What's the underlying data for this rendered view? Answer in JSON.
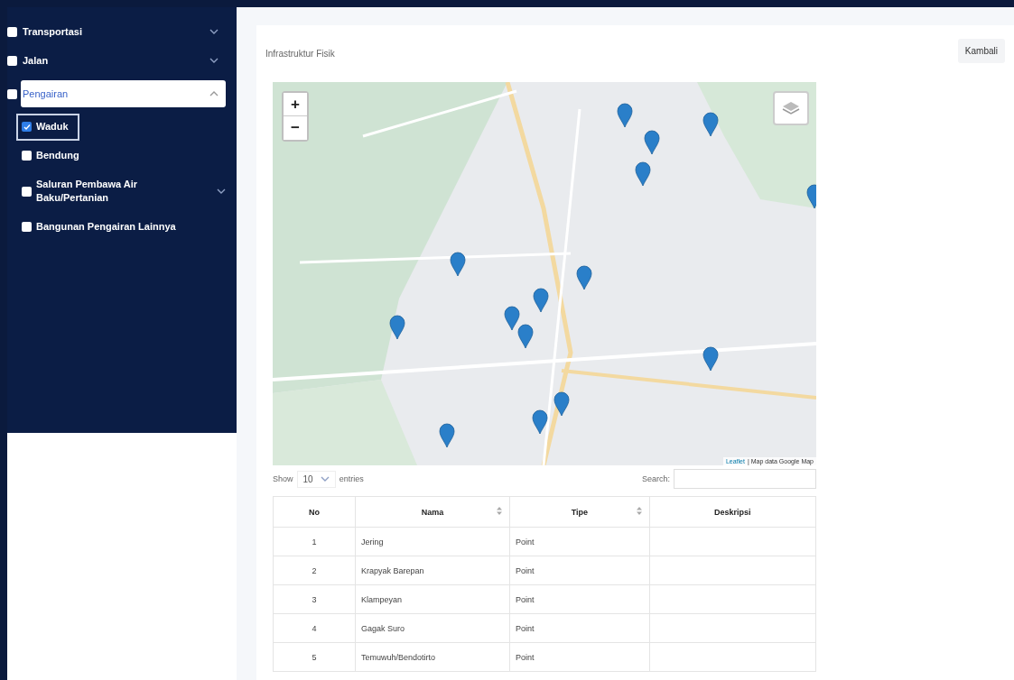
{
  "sidebar": {
    "items": [
      {
        "label": "Transportasi",
        "checked": false,
        "expanded": false
      },
      {
        "label": "Jalan",
        "checked": false,
        "expanded": false
      },
      {
        "label": "Pengairan",
        "checked": false,
        "expanded": true,
        "children": [
          {
            "label": "Waduk",
            "checked": true,
            "selected": true
          },
          {
            "label": "Bendung",
            "checked": false,
            "selected": false
          },
          {
            "label": "Saluran Pembawa Air Baku/Pertanian",
            "checked": false,
            "selected": false,
            "expanded": false
          },
          {
            "label": "Bangunan Pengairan Lainnya",
            "checked": false,
            "selected": false
          }
        ]
      }
    ]
  },
  "header": {
    "title": "Infrastruktur Fisik",
    "button": "Kambali"
  },
  "map": {
    "zoom_in": "+",
    "zoom_out": "−",
    "attribution_prefix": "Leaflet",
    "attribution": "| Map data Google Map"
  },
  "table_controls": {
    "show_label": "Show",
    "page_size": "10",
    "entries_label": "entries",
    "search_label": "Search:"
  },
  "table": {
    "columns": [
      {
        "label": "No",
        "sortable": false
      },
      {
        "label": "Nama",
        "sortable": true
      },
      {
        "label": "Tipe",
        "sortable": true
      },
      {
        "label": "Deskripsi",
        "sortable": false
      }
    ],
    "rows": [
      [
        "1",
        "Jering",
        "Point",
        ""
      ],
      [
        "2",
        "Krapyak Barepan",
        "Point",
        ""
      ],
      [
        "3",
        "Klampeyan",
        "Point",
        ""
      ],
      [
        "4",
        "Gagak Suro",
        "Point",
        ""
      ],
      [
        "5",
        "Temuwuh/Bendotirto",
        "Point",
        ""
      ]
    ]
  }
}
